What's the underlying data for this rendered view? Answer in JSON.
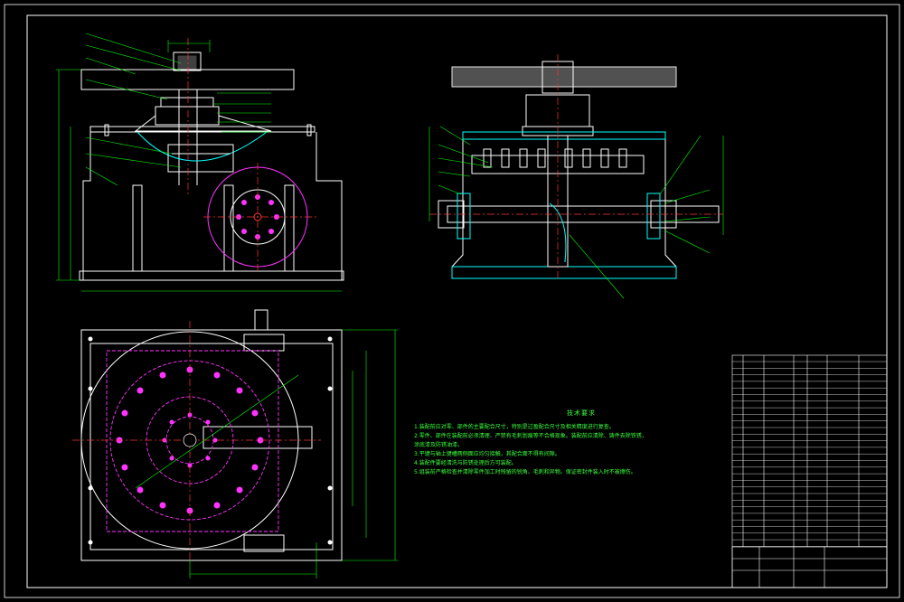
{
  "drawing": {
    "background": "#000000",
    "line_color": "#ffffff",
    "dim_color": "#00ff00",
    "center_color": "#ff3333",
    "hidden_color": "#ff33ff",
    "hatch_color": "#00ffff"
  },
  "tech_notes": {
    "title": "技术要求",
    "items": [
      "1.装配前应对零、部件的主要配合尺寸，特别是过盈配合尺寸及相关精度进行复查。",
      "2.零件、部件在装配前必须清理、严禁有毛刺划痕等不合格现象。装配前应清除、铸件去除铁锈，",
      "  涂底漆及防锈油漆。",
      "3.平键与轴上键槽两侧面应均匀接触，其配合面不得有间隙。",
      "4.装配件要经清洗与防锈处理后方可装配。",
      "5.组装前严格检查并清除零件加工时残留的锐角、毛刺和异物。保证密封件装入时不被擦伤。"
    ]
  }
}
